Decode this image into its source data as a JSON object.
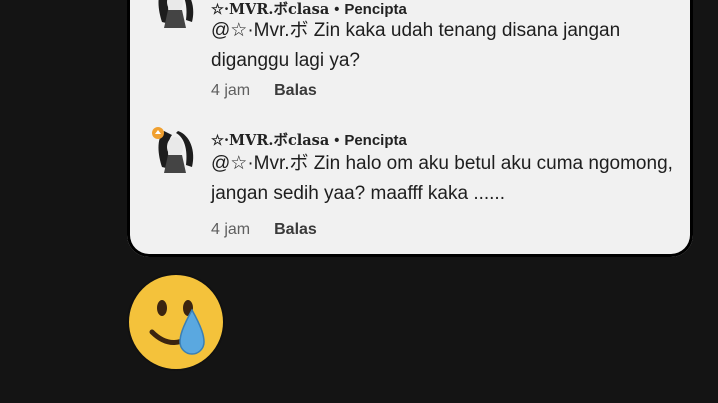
{
  "comments": [
    {
      "author": "☆·MVR.ボclasa",
      "role": "Pencipta",
      "text": "@☆·Mvr.ボ Zin kaka udah tenang disana jangan diganggu lagi ya?",
      "time": "4 jam",
      "reply_label": "Balas",
      "avatar_icon": "avatar-image"
    },
    {
      "author": "☆·MVR.ボclasa",
      "role": "Pencipta",
      "text": "@☆·Mvr.ボ Zin halo om aku betul aku cuma ngomong, jangan sedih yaa? maafff kaka ......",
      "time": "4 jam",
      "reply_label": "Balas",
      "avatar_icon": "avatar-image"
    }
  ],
  "reaction_emoji": "smiling-face-with-tear",
  "colors": {
    "background": "#141414",
    "card": "#f1f1f1",
    "creator_badge": "#f0a030",
    "emoji_face": "#f4c23b",
    "emoji_tear": "#5aa8e0"
  }
}
